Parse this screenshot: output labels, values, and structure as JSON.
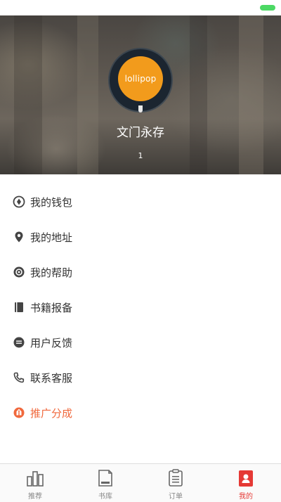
{
  "profile": {
    "avatar_text": "lollipop",
    "username": "文门永存",
    "level": "1"
  },
  "menu": {
    "items": [
      {
        "label": "我的钱包",
        "icon": "wallet-icon"
      },
      {
        "label": "我的地址",
        "icon": "location-pin-icon"
      },
      {
        "label": "我的帮助",
        "icon": "help-icon"
      },
      {
        "label": "书籍报备",
        "icon": "book-icon"
      },
      {
        "label": "用户反馈",
        "icon": "feedback-icon"
      },
      {
        "label": "联系客服",
        "icon": "phone-icon"
      },
      {
        "label": "推广分成",
        "icon": "promotion-icon"
      }
    ]
  },
  "tabbar": {
    "items": [
      {
        "label": "推荐",
        "icon": "recommend-icon"
      },
      {
        "label": "书库",
        "icon": "library-icon"
      },
      {
        "label": "订单",
        "icon": "order-icon"
      },
      {
        "label": "我的",
        "icon": "profile-icon",
        "active": true
      }
    ]
  },
  "colors": {
    "accent": "#e53935",
    "promo": "#f0683c",
    "battery": "#4cd964",
    "avatar": "#f29b1c"
  }
}
